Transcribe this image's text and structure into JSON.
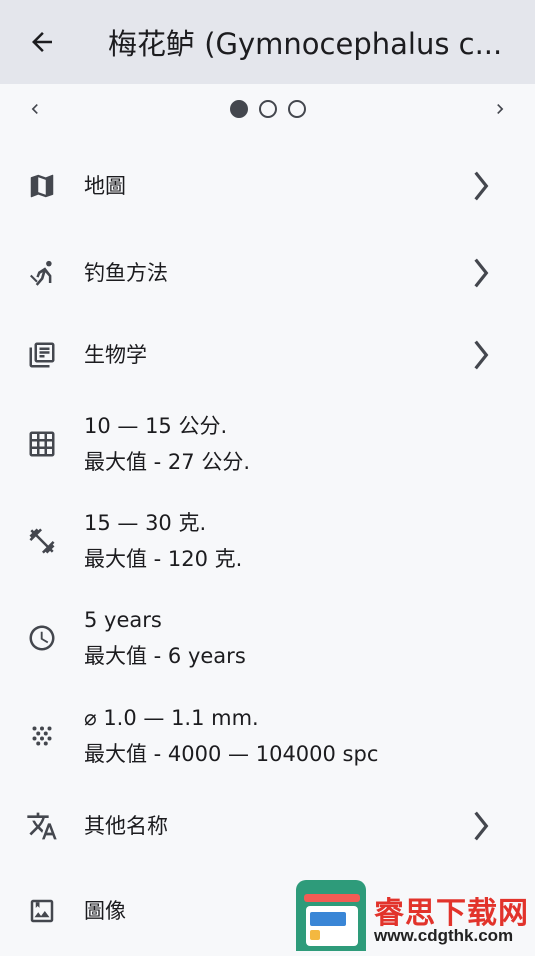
{
  "appbar": {
    "title": "梅花鲈 (Gymnocephalus c..."
  },
  "pager": {
    "dots": 3,
    "active_index": 0
  },
  "rows": [
    {
      "label": "地圖",
      "icon": "map-icon"
    },
    {
      "label": "钓鱼方法",
      "icon": "fishing-icon"
    },
    {
      "label": "生物学",
      "icon": "library-books-icon"
    },
    {
      "line1": "10 — 15 公分.",
      "line2": "最大值 - 27 公分.",
      "icon": "grid-icon"
    },
    {
      "line1": "15 — 30 克.",
      "line2": "最大值 - 120 克.",
      "icon": "dumbbell-icon"
    },
    {
      "line1": "5 years",
      "line2": "最大值 - 6 years",
      "icon": "clock-icon"
    },
    {
      "line1": "⌀ 1.0 — 1.1 mm.",
      "line2": "最大值 - 4000 — 104000 spc",
      "icon": "eggs-icon"
    },
    {
      "label": "其他名称",
      "icon": "translate-icon"
    },
    {
      "label": "圖像",
      "icon": "image-icon"
    }
  ],
  "watermark": {
    "text": "睿思下载网",
    "url": "www.cdgthk.com"
  },
  "colors": {
    "appbar_bg": "#e4e6ec",
    "page_bg": "#f7f8fa",
    "icon": "#44474e"
  }
}
